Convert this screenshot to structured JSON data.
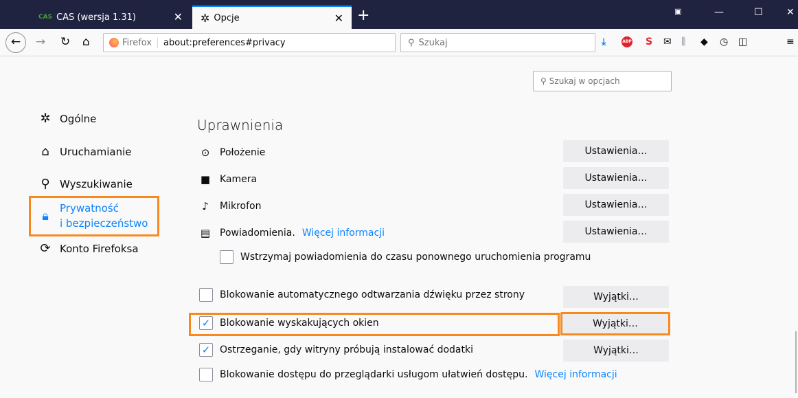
{
  "tabs": [
    {
      "favicon_text": "CAS",
      "title": "CAS (wersja 1.31)",
      "close": "✕"
    },
    {
      "title": "Opcje",
      "close": "✕"
    }
  ],
  "newtab": "+",
  "window_controls": {
    "minimize": "—",
    "maximize": "☐",
    "close": "✕"
  },
  "nav": {
    "back": "←",
    "forward": "→",
    "reload": "↻",
    "home": "⌂",
    "url_label": "Firefox",
    "url": "about:preferences#privacy",
    "search_placeholder": "Szukaj"
  },
  "options_search_placeholder": "Szukaj w opcjach",
  "sidebar": {
    "items": [
      {
        "label": "Ogólne",
        "icon": "gear-icon"
      },
      {
        "label": "Uruchamianie",
        "icon": "home-icon"
      },
      {
        "label": "Wyszukiwanie",
        "icon": "search-icon"
      },
      {
        "label_line1": "Prywatność",
        "label_line2": "i bezpieczeństwo",
        "icon": "lock-icon",
        "selected": true
      },
      {
        "label": "Konto Firefoksa",
        "icon": "sync-icon"
      }
    ]
  },
  "permissions": {
    "title": "Uprawnienia",
    "rows": [
      {
        "label": "Położenie",
        "button": "Ustawienia…"
      },
      {
        "label": "Kamera",
        "button": "Ustawienia…"
      },
      {
        "label": "Mikrofon",
        "button": "Ustawienia…"
      },
      {
        "label": "Powiadomienia.",
        "link": "Więcej informacji",
        "button": "Ustawienia…"
      }
    ],
    "pause_notifications": {
      "label": "Wstrzymaj powiadomienia do czasu ponownego uruchomienia programu",
      "checked": false
    },
    "checkboxes": [
      {
        "label": "Blokowanie automatycznego odtwarzania dźwięku przez strony",
        "checked": false,
        "button": "Wyjątki…"
      },
      {
        "label": "Blokowanie wyskakujących okien",
        "checked": true,
        "button": "Wyjątki…"
      },
      {
        "label": "Ostrzeganie, gdy witryny próbują instalować dodatki",
        "checked": true,
        "button": "Wyjątki…"
      },
      {
        "label": "Blokowanie dostępu do przeglądarki usługom ułatwień dostępu.",
        "link": "Więcej informacji",
        "checked": false
      }
    ]
  },
  "accent_colors": {
    "highlight": "#f7891e",
    "link": "#0a84ff",
    "titlebar": "#202340"
  }
}
